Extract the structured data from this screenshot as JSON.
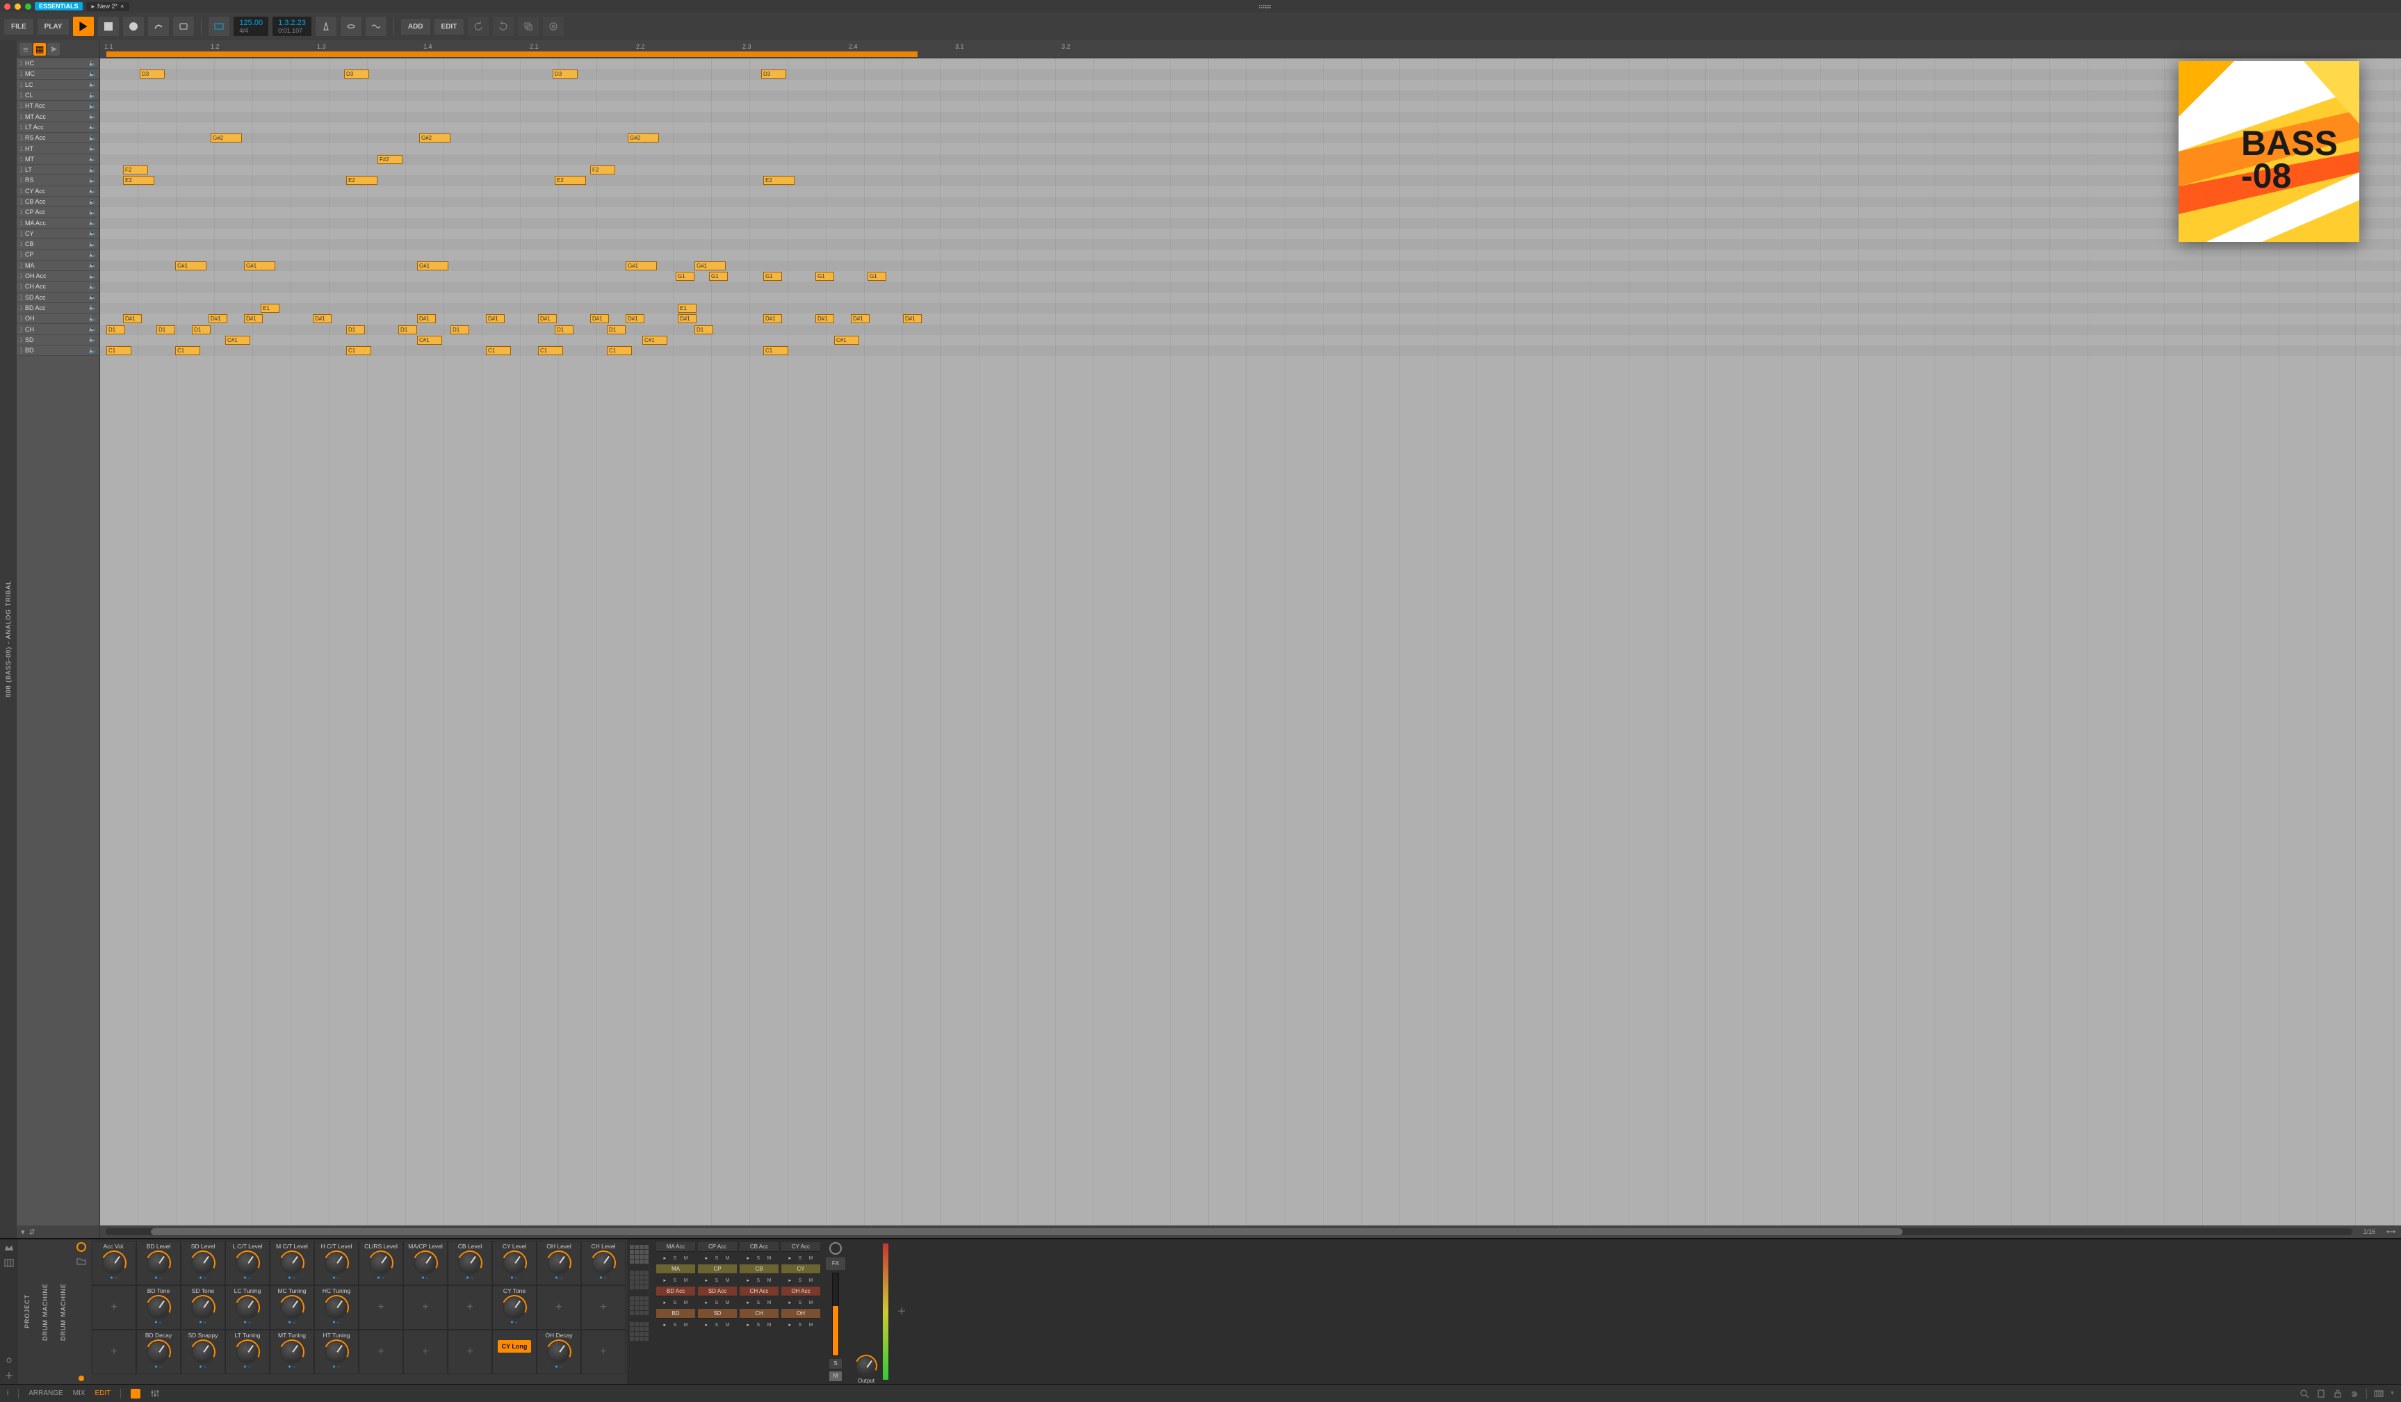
{
  "titlebar": {
    "badge": "ESSENTIALS",
    "tab_prefix": "▸",
    "tab_name": "New 2*",
    "tab_close": "×"
  },
  "toolbar": {
    "file": "FILE",
    "play": "PLAY",
    "add": "ADD",
    "edit": "EDIT",
    "tempo": "125.00",
    "sig": "4/4",
    "pos": "1.3.2.23",
    "time": "0:01.107"
  },
  "sidebar_title": "808 (BASS-08) - ANALOG TRIBAL",
  "tracks": [
    "HC",
    "MC",
    "LC",
    "CL",
    "HT Acc",
    "MT Acc",
    "LT Acc",
    "RS Acc",
    "HT",
    "MT",
    "LT",
    "RS",
    "CY Acc",
    "CB Acc",
    "CP Acc",
    "MA Acc",
    "CY",
    "CB",
    "CP",
    "MA",
    "OH Acc",
    "CH Acc",
    "SD Acc",
    "BD Acc",
    "OH",
    "CH",
    "SD",
    "BD"
  ],
  "track_num": "1",
  "ruler": [
    "1.1",
    "1.2",
    "1.3",
    "1.4",
    "2.1",
    "2.2",
    "2.3",
    "2.4",
    "3.1",
    "3.2"
  ],
  "zoom_label": "1/16",
  "notes": [
    {
      "r": 1,
      "b": 0.38,
      "len": 0.4,
      "t": "D3"
    },
    {
      "r": 1,
      "b": 2.34,
      "len": 0.4,
      "t": "D3"
    },
    {
      "r": 1,
      "b": 4.34,
      "len": 0.4,
      "t": "D3"
    },
    {
      "r": 1,
      "b": 6.34,
      "len": 0.4,
      "t": "D3"
    },
    {
      "r": 7,
      "b": 1.06,
      "len": 0.5,
      "t": "G#2"
    },
    {
      "r": 7,
      "b": 3.06,
      "len": 0.5,
      "t": "G#2"
    },
    {
      "r": 7,
      "b": 5.06,
      "len": 0.5,
      "t": "G#2"
    },
    {
      "r": 9,
      "b": 2.66,
      "len": 0.4,
      "t": "F#2"
    },
    {
      "r": 10,
      "b": 0.22,
      "len": 0.4,
      "t": "F2"
    },
    {
      "r": 10,
      "b": 4.7,
      "len": 0.4,
      "t": "F2"
    },
    {
      "r": 11,
      "b": 0.22,
      "len": 0.5,
      "t": "E2"
    },
    {
      "r": 11,
      "b": 2.36,
      "len": 0.5,
      "t": "E2"
    },
    {
      "r": 11,
      "b": 4.36,
      "len": 0.5,
      "t": "E2"
    },
    {
      "r": 11,
      "b": 6.36,
      "len": 0.5,
      "t": "E2"
    },
    {
      "r": 19,
      "b": 0.72,
      "len": 0.5,
      "t": "G#1"
    },
    {
      "r": 19,
      "b": 1.38,
      "len": 0.5,
      "t": "G#1"
    },
    {
      "r": 19,
      "b": 3.04,
      "len": 0.5,
      "t": "G#1"
    },
    {
      "r": 19,
      "b": 5.04,
      "len": 0.5,
      "t": "G#1"
    },
    {
      "r": 19,
      "b": 5.7,
      "len": 0.5,
      "t": "G#1"
    },
    {
      "r": 20,
      "b": 5.52,
      "len": 0.3,
      "t": "G1"
    },
    {
      "r": 20,
      "b": 5.84,
      "len": 0.3,
      "t": "G1"
    },
    {
      "r": 20,
      "b": 6.36,
      "len": 0.3,
      "t": "G1"
    },
    {
      "r": 20,
      "b": 6.86,
      "len": 0.3,
      "t": "G1"
    },
    {
      "r": 20,
      "b": 7.36,
      "len": 0.3,
      "t": "G1"
    },
    {
      "r": 23,
      "b": 1.54,
      "len": 0.3,
      "t": "E1"
    },
    {
      "r": 23,
      "b": 5.54,
      "len": 0.3,
      "t": "E1"
    },
    {
      "r": 24,
      "b": 0.22,
      "len": 0.3,
      "t": "D#1"
    },
    {
      "r": 24,
      "b": 1.04,
      "len": 0.3,
      "t": "D#1"
    },
    {
      "r": 24,
      "b": 1.38,
      "len": 0.3,
      "t": "D#1"
    },
    {
      "r": 24,
      "b": 2.04,
      "len": 0.3,
      "t": "D#1"
    },
    {
      "r": 24,
      "b": 3.04,
      "len": 0.3,
      "t": "D#1"
    },
    {
      "r": 24,
      "b": 3.7,
      "len": 0.3,
      "t": "D#1"
    },
    {
      "r": 24,
      "b": 4.2,
      "len": 0.3,
      "t": "D#1"
    },
    {
      "r": 24,
      "b": 4.7,
      "len": 0.3,
      "t": "D#1"
    },
    {
      "r": 24,
      "b": 5.04,
      "len": 0.3,
      "t": "D#1"
    },
    {
      "r": 24,
      "b": 5.54,
      "len": 0.3,
      "t": "D#1"
    },
    {
      "r": 24,
      "b": 6.36,
      "len": 0.3,
      "t": "D#1"
    },
    {
      "r": 24,
      "b": 6.86,
      "len": 0.3,
      "t": "D#1"
    },
    {
      "r": 24,
      "b": 7.2,
      "len": 0.3,
      "t": "D#1"
    },
    {
      "r": 24,
      "b": 7.7,
      "len": 0.3,
      "t": "D#1"
    },
    {
      "r": 25,
      "b": 0.06,
      "len": 0.3,
      "t": "D1"
    },
    {
      "r": 25,
      "b": 0.54,
      "len": 0.3,
      "t": "D1"
    },
    {
      "r": 25,
      "b": 0.88,
      "len": 0.3,
      "t": "D1"
    },
    {
      "r": 25,
      "b": 2.36,
      "len": 0.3,
      "t": "D1"
    },
    {
      "r": 25,
      "b": 2.86,
      "len": 0.3,
      "t": "D1"
    },
    {
      "r": 25,
      "b": 3.36,
      "len": 0.3,
      "t": "D1"
    },
    {
      "r": 25,
      "b": 4.36,
      "len": 0.3,
      "t": "D1"
    },
    {
      "r": 25,
      "b": 4.86,
      "len": 0.3,
      "t": "D1"
    },
    {
      "r": 25,
      "b": 5.7,
      "len": 0.3,
      "t": "D1"
    },
    {
      "r": 26,
      "b": 1.2,
      "len": 0.4,
      "t": "C#1"
    },
    {
      "r": 26,
      "b": 3.04,
      "len": 0.4,
      "t": "C#1"
    },
    {
      "r": 26,
      "b": 5.2,
      "len": 0.4,
      "t": "C#1"
    },
    {
      "r": 26,
      "b": 7.04,
      "len": 0.4,
      "t": "C#1"
    },
    {
      "r": 27,
      "b": 0.06,
      "len": 0.4,
      "t": "C1"
    },
    {
      "r": 27,
      "b": 0.72,
      "len": 0.4,
      "t": "C1"
    },
    {
      "r": 27,
      "b": 2.36,
      "len": 0.4,
      "t": "C1"
    },
    {
      "r": 27,
      "b": 3.7,
      "len": 0.4,
      "t": "C1"
    },
    {
      "r": 27,
      "b": 4.2,
      "len": 0.4,
      "t": "C1"
    },
    {
      "r": 27,
      "b": 4.86,
      "len": 0.4,
      "t": "C1"
    },
    {
      "r": 27,
      "b": 6.36,
      "len": 0.4,
      "t": "C1"
    }
  ],
  "loop": {
    "start": 0.06,
    "end": 7.84
  },
  "knobs_row1": [
    "Acc Vol.",
    "BD Level",
    "SD Level",
    "L C/T Level",
    "M C/T Level",
    "H C/T Level",
    "CL/RS Level",
    "MA/CP Level",
    "CB Level",
    "CY Level",
    "OH Level",
    "CH Level"
  ],
  "knobs_row2": [
    "",
    "BD Tone",
    "SD Tone",
    "LC Tuning",
    "MC Tuning",
    "HC Tuning",
    "",
    "",
    "",
    "CY Tone",
    "",
    ""
  ],
  "knobs_row3": [
    "",
    "BD Decay",
    "SD Snappy",
    "LT Tuning",
    "MT Tuning",
    "HT Tuning",
    "",
    "",
    "",
    "",
    "OH Decay",
    ""
  ],
  "cy_long": "CY Long",
  "cells_cols": [
    {
      "rows": [
        "MA Acc",
        "MA",
        "BD Acc",
        "BD"
      ]
    },
    {
      "rows": [
        "CP Acc",
        "CP",
        "SD Acc",
        "SD"
      ]
    },
    {
      "rows": [
        "CB Acc",
        "CB",
        "CH Acc",
        "CH"
      ]
    },
    {
      "rows": [
        "CY Acc",
        "CY",
        "OH Acc",
        "OH"
      ]
    }
  ],
  "cell_play": "▸",
  "cell_s": "S",
  "cell_m": "M",
  "fx_label": "FX",
  "output_label": "Output",
  "footer": {
    "info": "i",
    "arrange": "ARRANGE",
    "mix": "MIX",
    "edit": "EDIT"
  },
  "device_label": "DRUM MACHINE",
  "project_label": "PROJECT",
  "art": {
    "line1": "BASS",
    "line2": "-08"
  }
}
